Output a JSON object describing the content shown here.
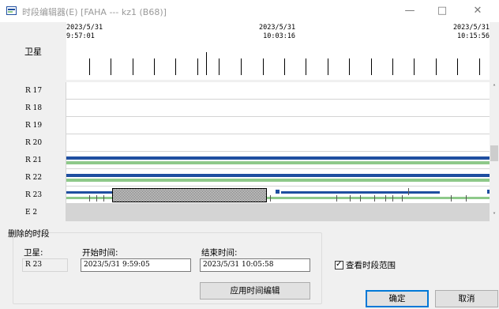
{
  "window": {
    "title": "时段编辑器(E) [FAHA --- kz1 (B68)]",
    "minimize": "—",
    "maximize": "□",
    "close": "✕"
  },
  "timeline": {
    "header_label": "卫星",
    "left_date": "2023/5/31",
    "left_time": "9:57:01",
    "mid_date": "2023/5/31",
    "mid_time": "10:03:16",
    "right_date": "2023/5/31",
    "right_time": "10:15:56"
  },
  "rows": [
    {
      "label": "R 17",
      "enabled": true
    },
    {
      "label": "R 18",
      "enabled": true
    },
    {
      "label": "R 19",
      "enabled": true
    },
    {
      "label": "R 20",
      "enabled": true
    },
    {
      "label": "R 21",
      "enabled": true
    },
    {
      "label": "R 22",
      "enabled": true
    },
    {
      "label": "R 23",
      "enabled": true
    },
    {
      "label": "E 2",
      "enabled": false
    }
  ],
  "colors": {
    "blue_bar": "#1f4fa0",
    "green_bar": "#8ec98a",
    "selection": "#9e9e9e"
  },
  "scrollbar": {
    "up": "˄",
    "down": "˅"
  },
  "delete_group": {
    "title": "删除的时段",
    "satellite_label": "卫星:",
    "satellite_value": "R 23",
    "start_label": "开始时间:",
    "start_value": "2023/5/31 9:59:05",
    "end_label": "结束时间:",
    "end_value": "2023/5/31 10:05:58",
    "apply_button": "应用时间编辑"
  },
  "view_range": {
    "label": "查看时段范围",
    "checked": true,
    "mark": "✓"
  },
  "buttons": {
    "ok": "确定",
    "cancel": "取消"
  }
}
